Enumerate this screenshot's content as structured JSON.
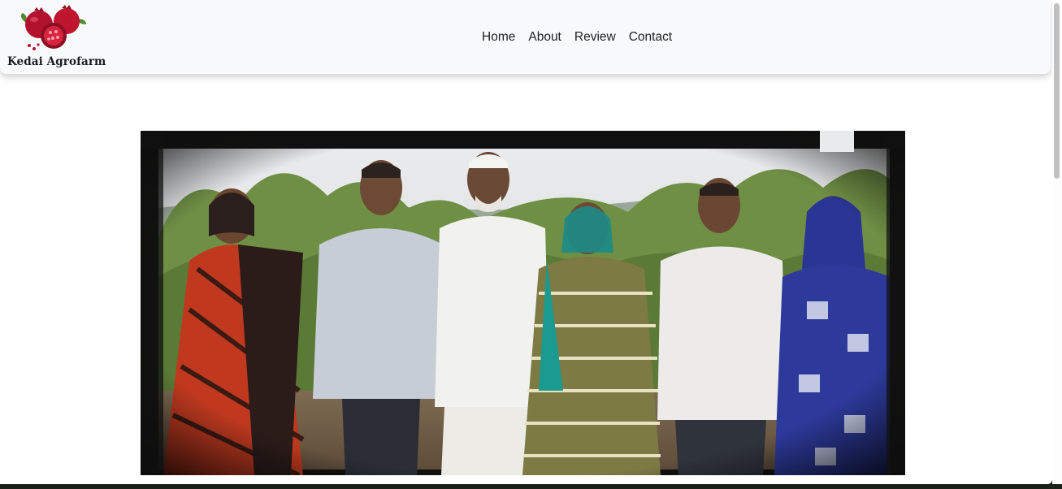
{
  "brand": {
    "name": "Kedai Agrofarm",
    "logo_icon": "pomegranate-icon"
  },
  "nav": {
    "items": [
      {
        "label": "Home"
      },
      {
        "label": "About"
      },
      {
        "label": "Review"
      },
      {
        "label": "Contact"
      }
    ]
  },
  "hero": {
    "image_subject": "group-photo-of-six-farmers"
  },
  "colors": {
    "navbar_bg": "#f8f9fa",
    "page_bg": "#ffffff",
    "pomegranate_red": "#b3122e",
    "leaf_green": "#4f8a2c"
  }
}
